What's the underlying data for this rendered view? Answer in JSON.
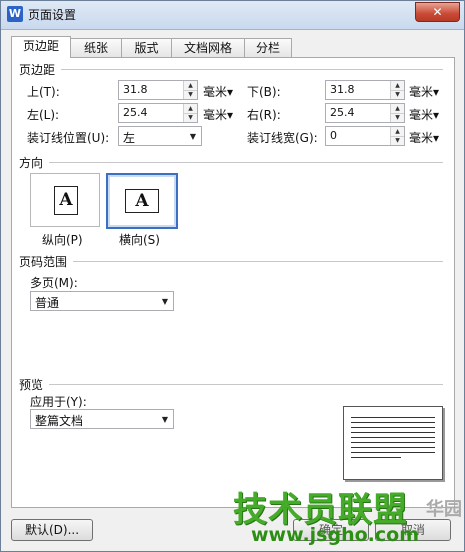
{
  "window": {
    "title": "页面设置",
    "app_icon": "W",
    "close_label": "✕"
  },
  "tabs": [
    {
      "label": "页边距"
    },
    {
      "label": "纸张"
    },
    {
      "label": "版式"
    },
    {
      "label": "文档网格"
    },
    {
      "label": "分栏"
    }
  ],
  "margins": {
    "section": "页边距",
    "top": {
      "label": "上(T):",
      "value": "31.8",
      "unit": "毫米▾"
    },
    "bottom": {
      "label": "下(B):",
      "value": "31.8",
      "unit": "毫米▾"
    },
    "left": {
      "label": "左(L):",
      "value": "25.4",
      "unit": "毫米▾"
    },
    "right": {
      "label": "右(R):",
      "value": "25.4",
      "unit": "毫米▾"
    },
    "gutter_pos": {
      "label": "装订线位置(U):",
      "value": "左"
    },
    "gutter_width": {
      "label": "装订线宽(G):",
      "value": "0",
      "unit": "毫米▾"
    }
  },
  "orientation": {
    "section": "方向",
    "portrait": {
      "label": "纵向(P)",
      "glyph": "A",
      "icon": "portrait-page-icon"
    },
    "landscape": {
      "label": "横向(S)",
      "glyph": "A",
      "icon": "landscape-page-icon",
      "selected": true
    }
  },
  "page_range": {
    "section": "页码范围",
    "multi_label": "多页(M):",
    "multi_value": "普通"
  },
  "preview": {
    "section": "预览",
    "apply_label": "应用于(Y):",
    "apply_value": "整篇文档"
  },
  "buttons": {
    "default": "默认(D)...",
    "ok": "确定",
    "cancel": "取消"
  },
  "watermark": {
    "text": "技术员联盟",
    "url": "www.jsgho.com",
    "extra": "华园"
  },
  "colors": {
    "accent": "#3b6fc2",
    "close": "#c94a36",
    "watermark": "#3ca81e"
  }
}
